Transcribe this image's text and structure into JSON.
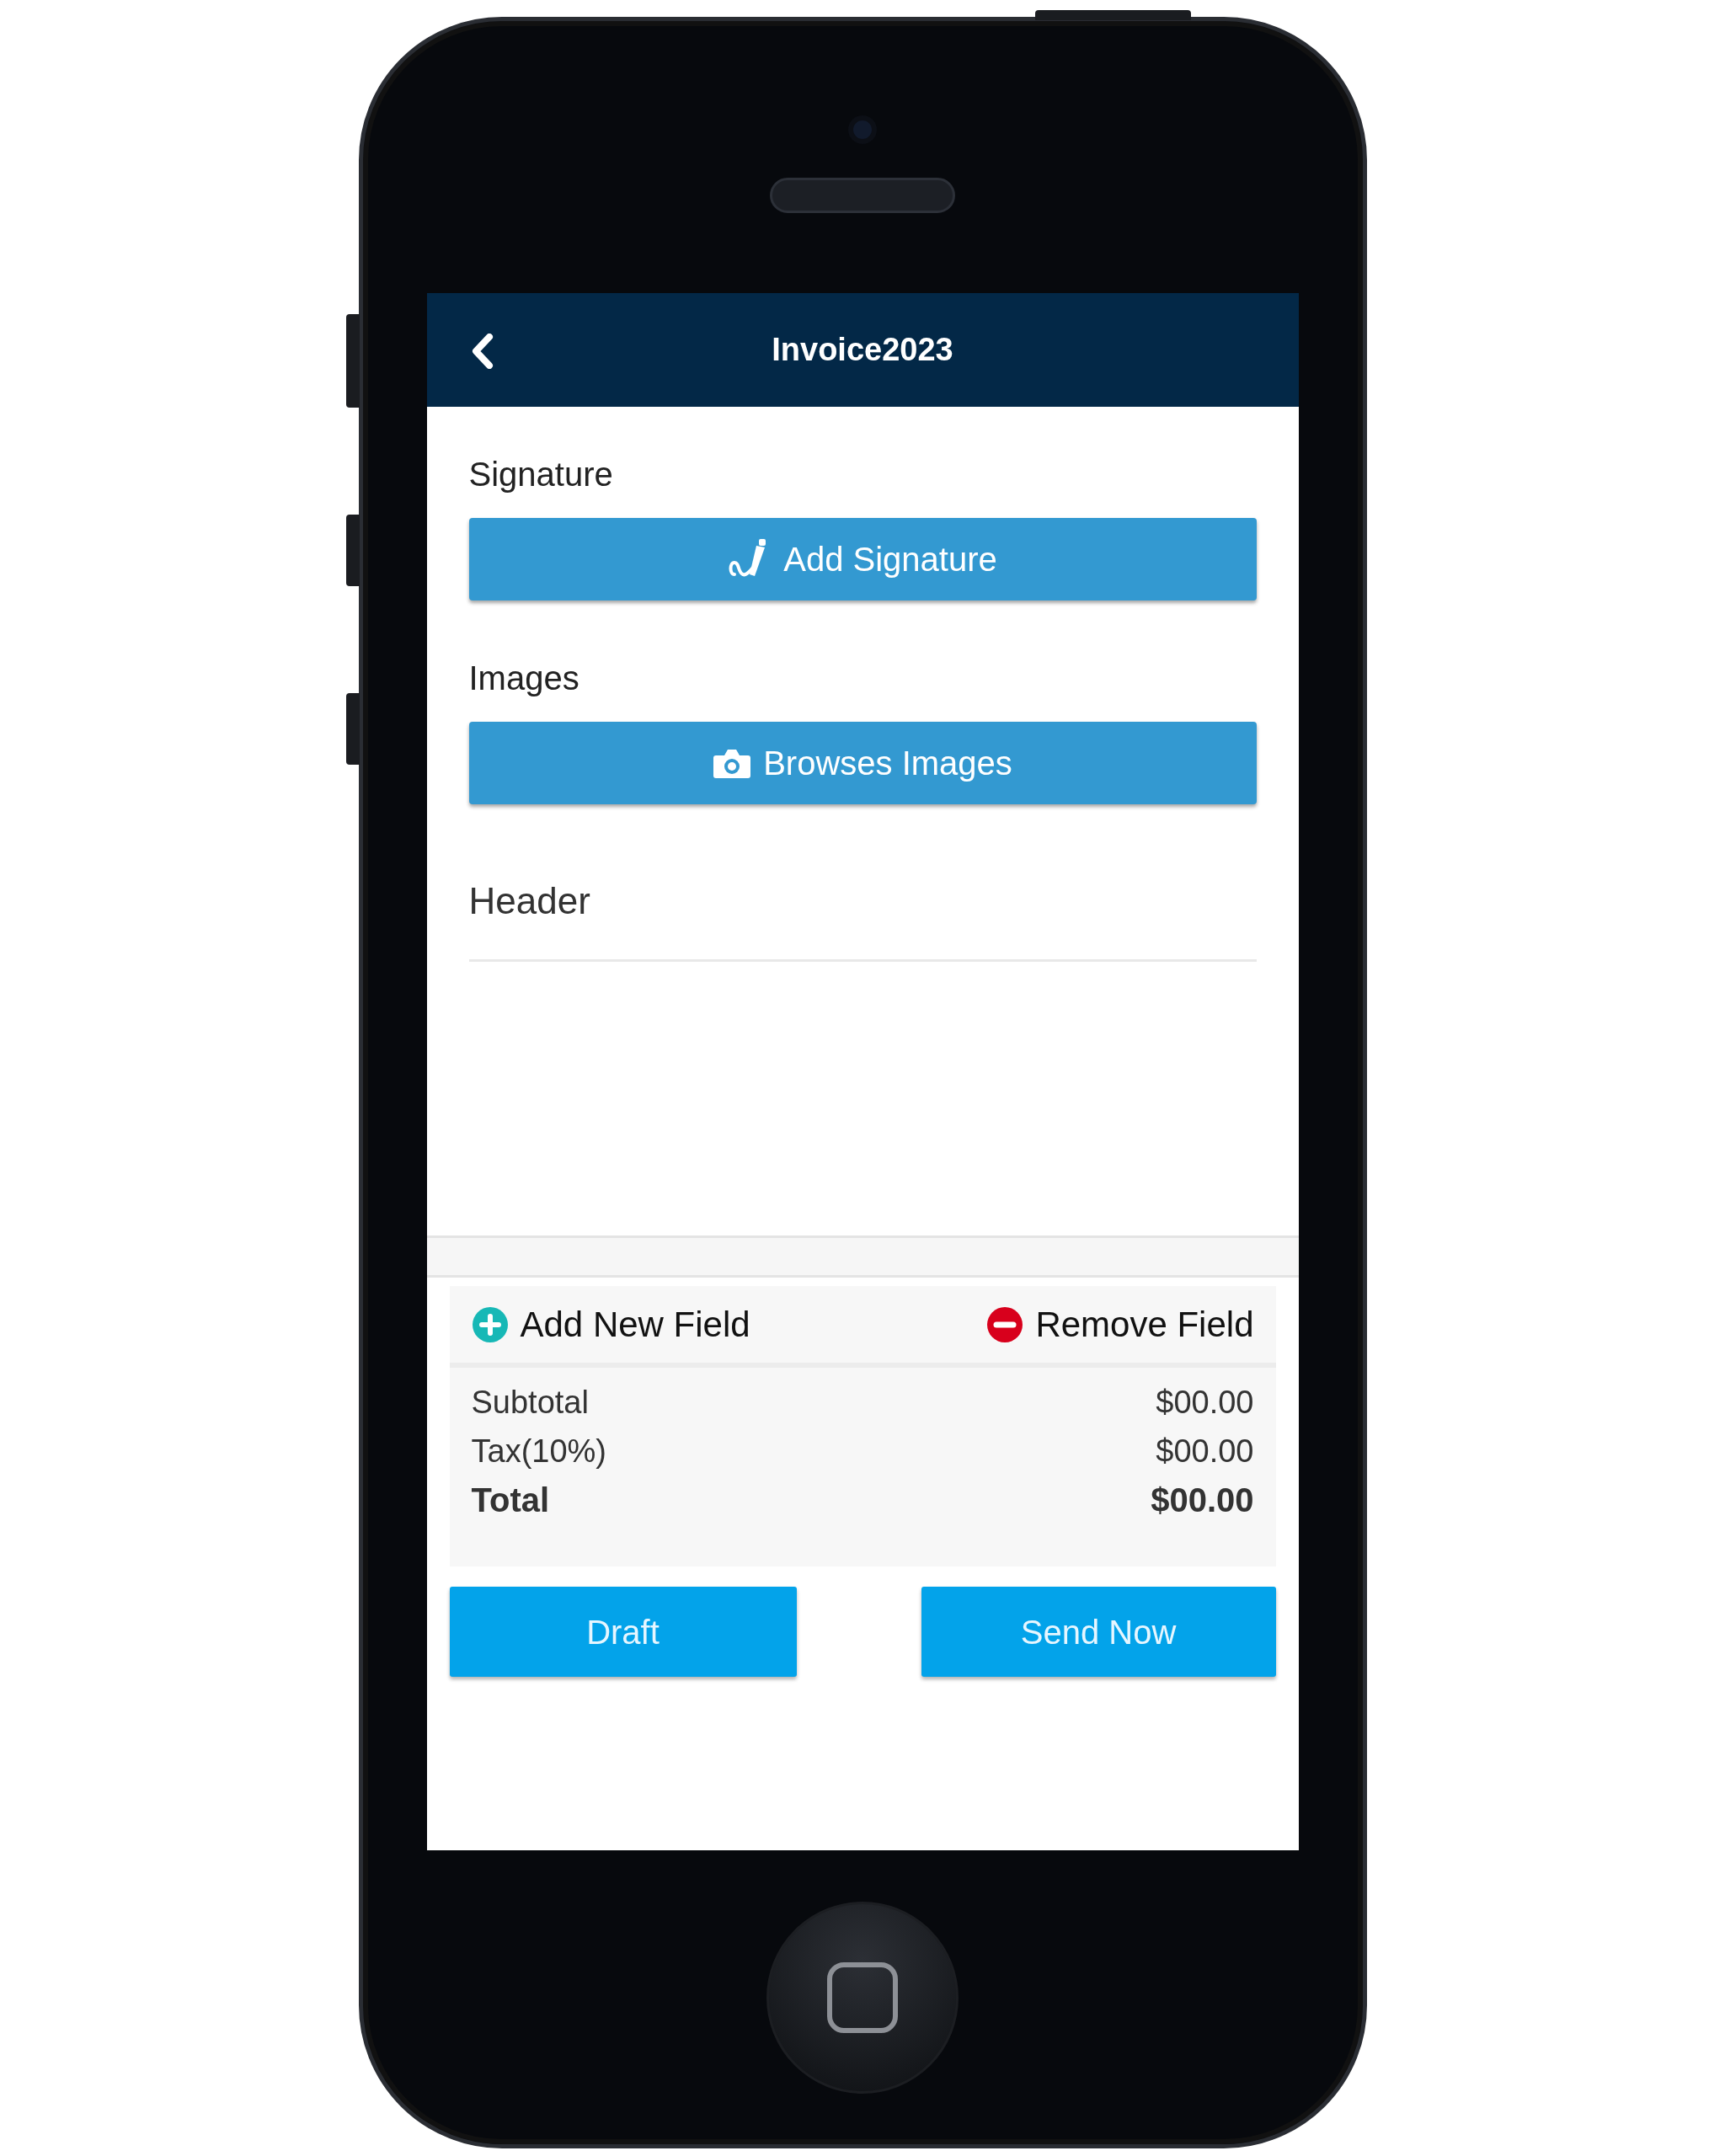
{
  "header": {
    "title": "Invoice2023"
  },
  "sections": [
    {
      "label": "Signature",
      "button": "Add Signature",
      "kind": "signature"
    },
    {
      "label": "Images",
      "button": "Browses Images",
      "kind": "camera"
    }
  ],
  "header_field": {
    "placeholder": "Header"
  },
  "field_actions": [
    {
      "label": "Add New Field",
      "kind": "add"
    },
    {
      "label": "Remove Field",
      "kind": "remove"
    }
  ],
  "totals": [
    {
      "label": "Subtotal",
      "value": "$00.00",
      "bold": false
    },
    {
      "label": "Tax(10%)",
      "value": "$00.00",
      "bold": false
    },
    {
      "label": "Total",
      "value": "$00.00",
      "bold": true
    }
  ],
  "buttons": [
    "Draft",
    "Send Now"
  ]
}
